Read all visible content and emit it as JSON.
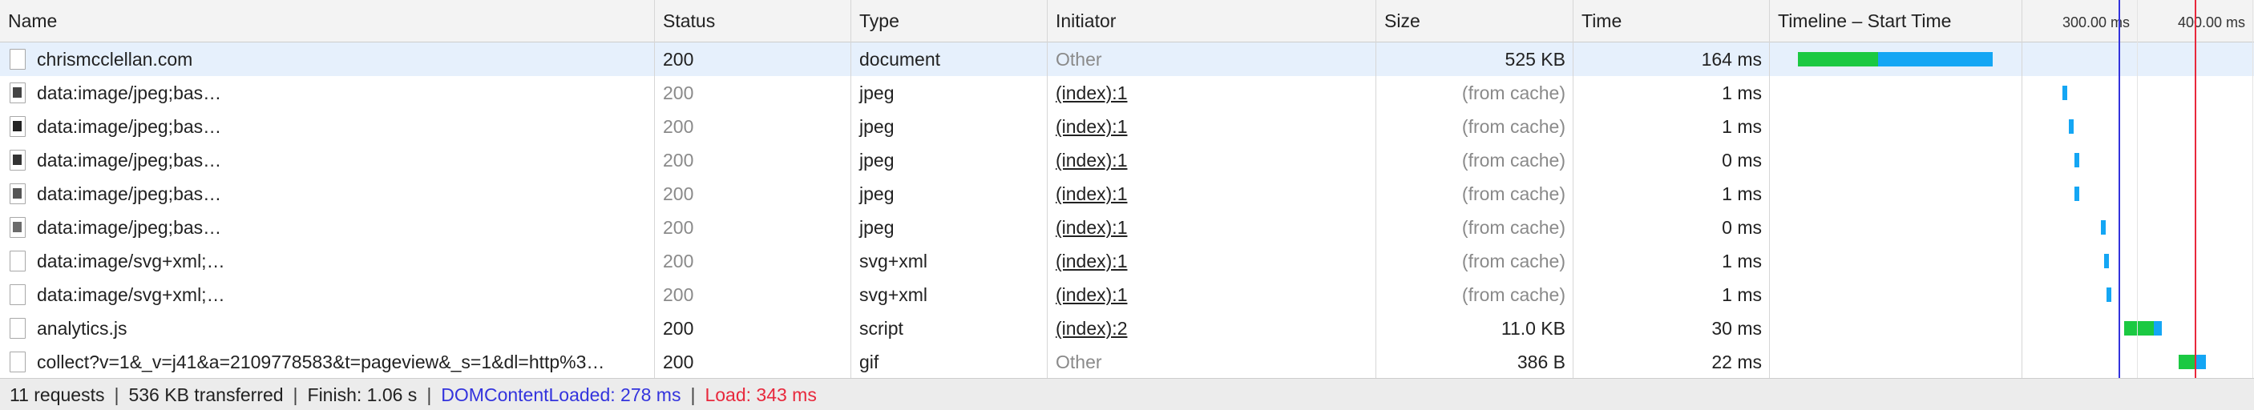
{
  "columns": {
    "name": "Name",
    "status": "Status",
    "type": "Type",
    "initiator": "Initiator",
    "size": "Size",
    "time": "Time",
    "timeline": "Timeline – Start Time"
  },
  "timeline_ticks": [
    "300.00 ms",
    "400.00 ms"
  ],
  "rows": [
    {
      "name": "chrismcclellan.com",
      "status": "200",
      "type": "document",
      "initiator": "Other",
      "size": "525 KB",
      "time": "164 ms",
      "icon": "document-icon"
    },
    {
      "name": "data:image/jpeg;bas…",
      "status": "200",
      "type": "jpeg",
      "initiator": "(index):1",
      "size": "(from cache)",
      "time": "1 ms",
      "icon": "image-thumbnail-icon"
    },
    {
      "name": "data:image/jpeg;bas…",
      "status": "200",
      "type": "jpeg",
      "initiator": "(index):1",
      "size": "(from cache)",
      "time": "1 ms",
      "icon": "image-thumbnail-icon"
    },
    {
      "name": "data:image/jpeg;bas…",
      "status": "200",
      "type": "jpeg",
      "initiator": "(index):1",
      "size": "(from cache)",
      "time": "0 ms",
      "icon": "image-thumbnail-icon"
    },
    {
      "name": "data:image/jpeg;bas…",
      "status": "200",
      "type": "jpeg",
      "initiator": "(index):1",
      "size": "(from cache)",
      "time": "1 ms",
      "icon": "image-thumbnail-icon"
    },
    {
      "name": "data:image/jpeg;bas…",
      "status": "200",
      "type": "jpeg",
      "initiator": "(index):1",
      "size": "(from cache)",
      "time": "0 ms",
      "icon": "image-thumbnail-icon"
    },
    {
      "name": "data:image/svg+xml;…",
      "status": "200",
      "type": "svg+xml",
      "initiator": "(index):1",
      "size": "(from cache)",
      "time": "1 ms",
      "icon": "file-icon"
    },
    {
      "name": "data:image/svg+xml;…",
      "status": "200",
      "type": "svg+xml",
      "initiator": "(index):1",
      "size": "(from cache)",
      "time": "1 ms",
      "icon": "file-icon"
    },
    {
      "name": "analytics.js",
      "status": "200",
      "type": "script",
      "initiator": "(index):2",
      "size": "11.0 KB",
      "time": "30 ms",
      "icon": "script-icon"
    },
    {
      "name": "collect?v=1&_v=j41&a=2109778583&t=pageview&_s=1&dl=http%3…",
      "status": "200",
      "type": "gif",
      "initiator": "Other",
      "size": "386 B",
      "time": "22 ms",
      "icon": "file-icon"
    }
  ],
  "footer": {
    "requests": "11 requests",
    "transferred": "536 KB transferred",
    "finish": "Finish: 1.06 s",
    "dom_content_loaded": "DOMContentLoaded: 278 ms",
    "load": "Load: 343 ms",
    "separator": "|"
  },
  "colors": {
    "waiting_green": "#1bc942",
    "receiving_blue": "#14a6f4",
    "dom_line": "#3333dd",
    "load_line": "#e8283c",
    "selected_row": "#e6f0fc"
  }
}
